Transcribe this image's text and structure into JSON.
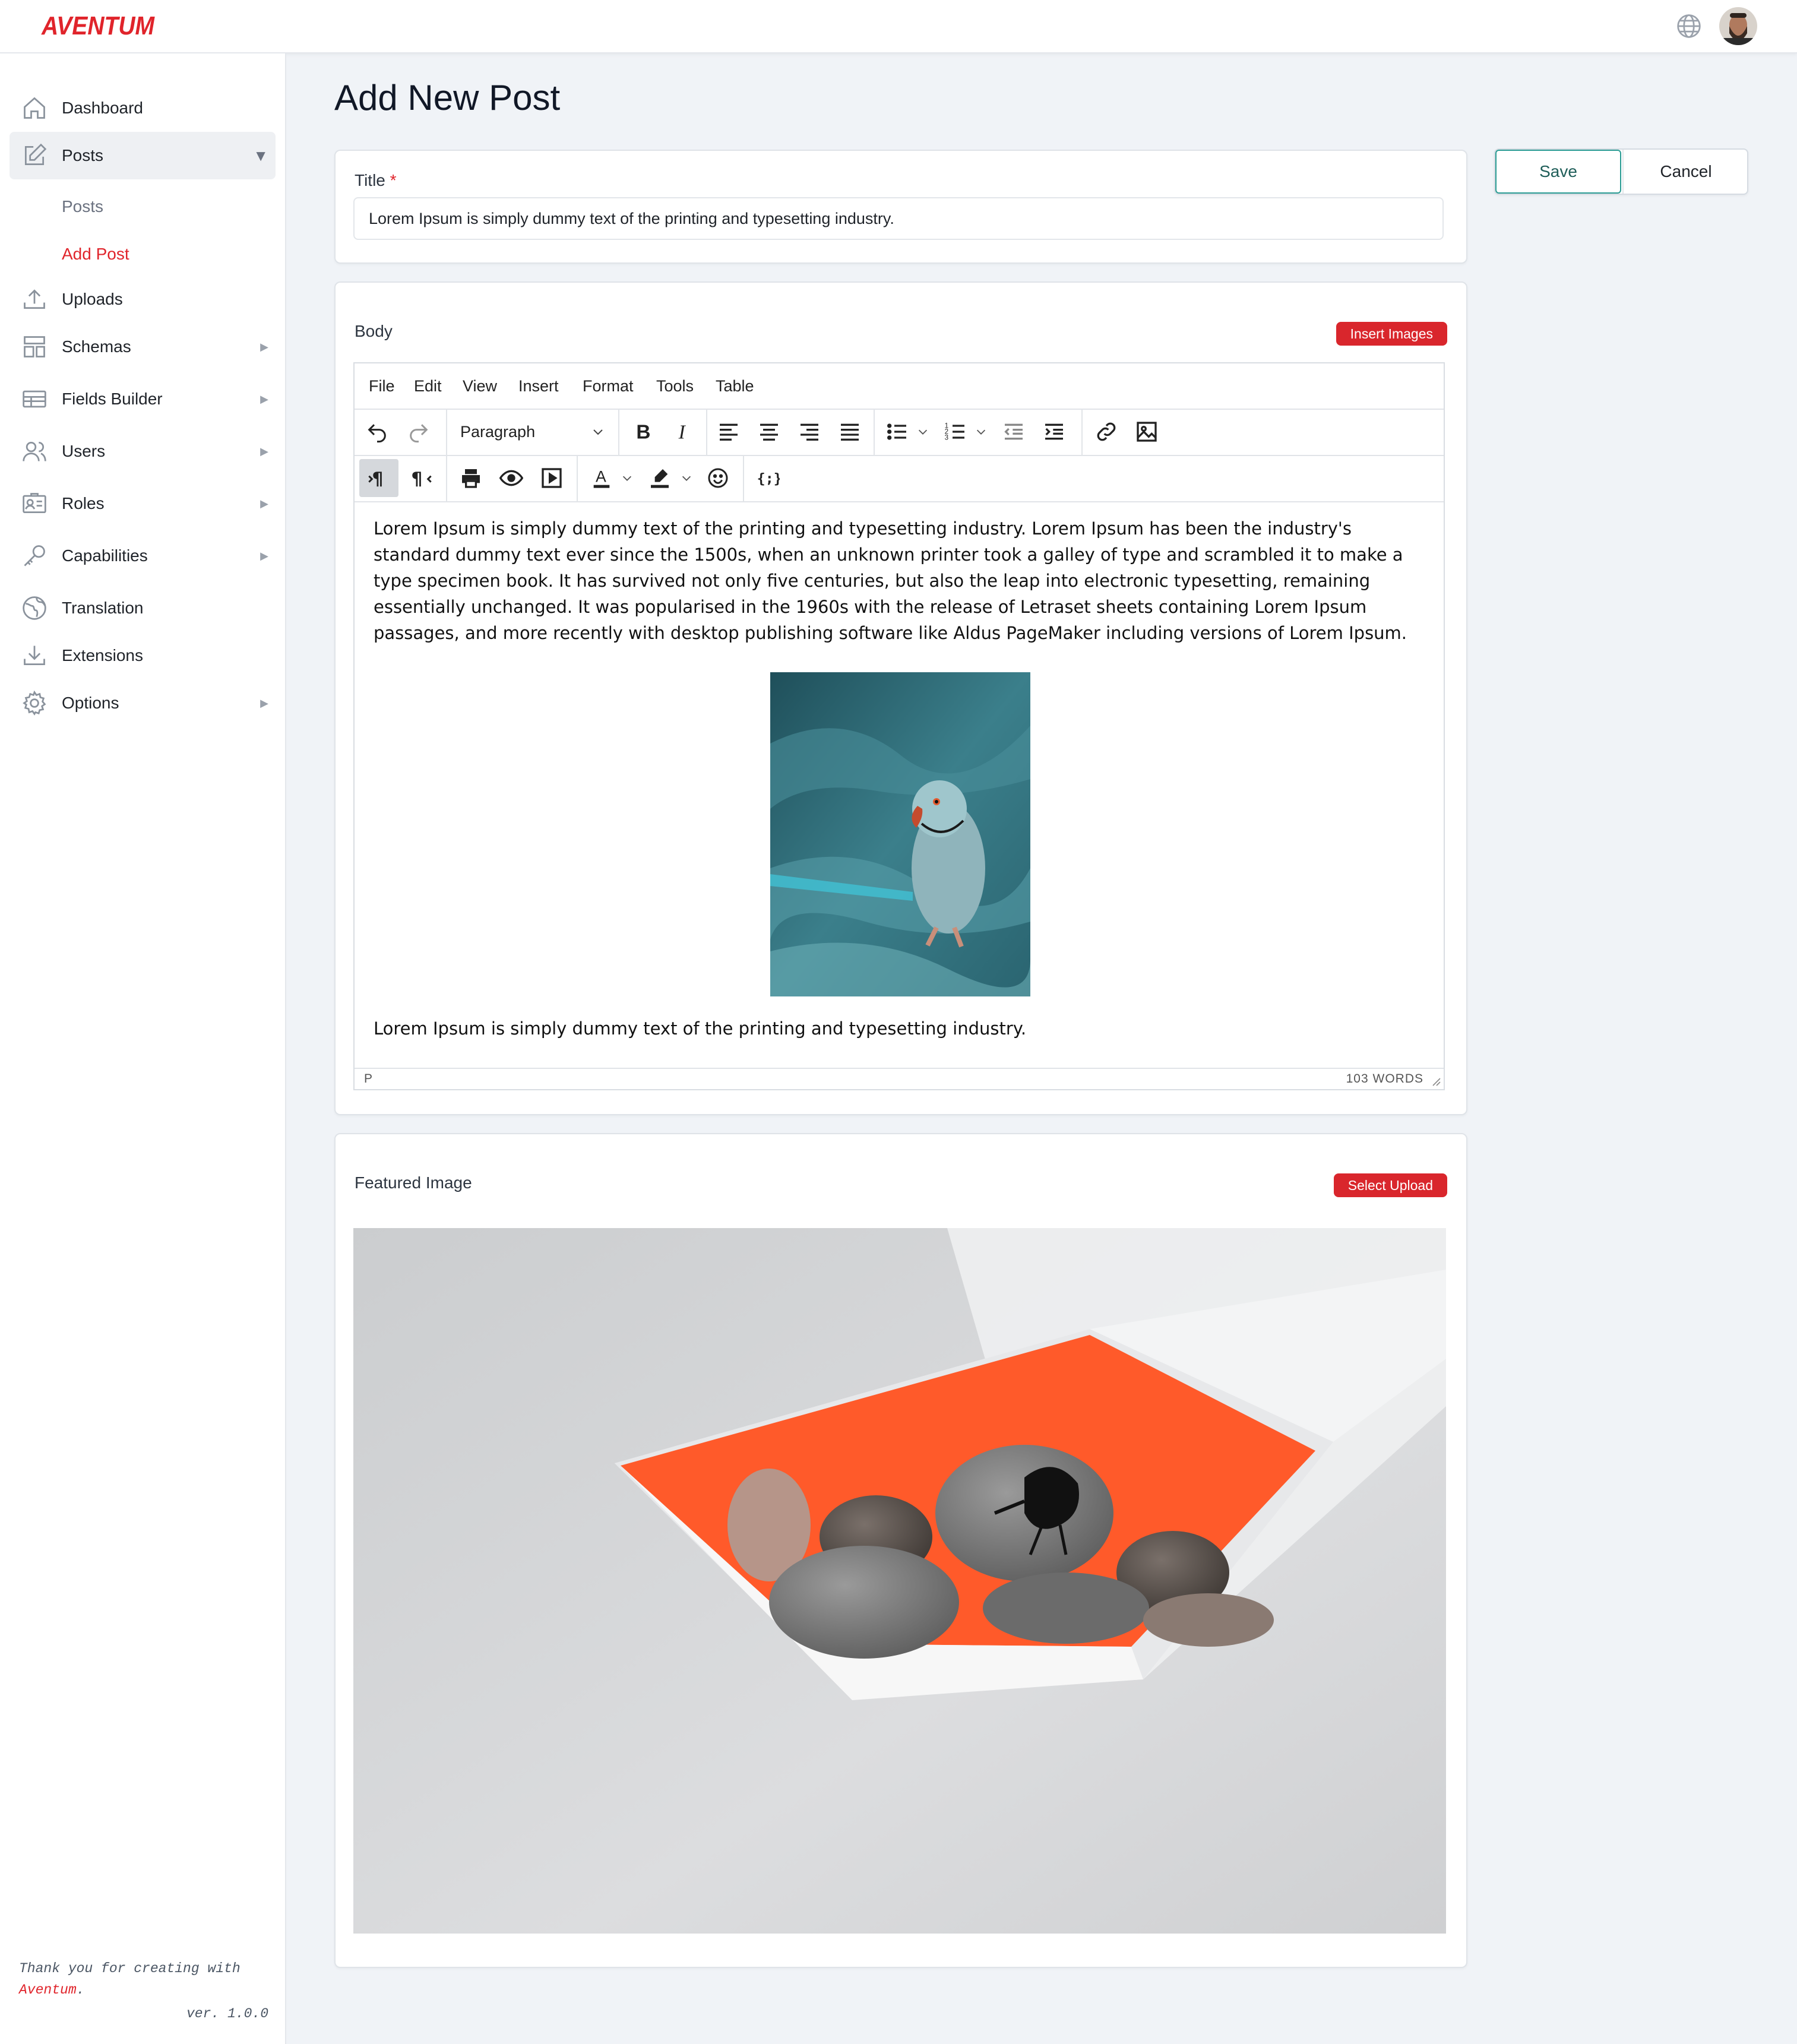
{
  "brand": {
    "logo_text": "AVENTUM"
  },
  "colors": {
    "accent": "#e0242b",
    "save_border": "#2b9c94",
    "page_bg": "#f0f3f7"
  },
  "header": {
    "language_icon": "globe-icon",
    "user_avatar": "avatar"
  },
  "sidebar": {
    "items": [
      {
        "label": "Dashboard",
        "icon": "home-icon"
      },
      {
        "label": "Posts",
        "icon": "edit-icon",
        "expanded": true
      },
      {
        "label": "Uploads",
        "icon": "upload-icon"
      },
      {
        "label": "Schemas",
        "icon": "layout-icon"
      },
      {
        "label": "Fields Builder",
        "icon": "table-icon"
      },
      {
        "label": "Users",
        "icon": "users-icon"
      },
      {
        "label": "Roles",
        "icon": "id-card-icon"
      },
      {
        "label": "Capabilities",
        "icon": "key-icon"
      },
      {
        "label": "Translation",
        "icon": "globe-icon"
      },
      {
        "label": "Extensions",
        "icon": "download-icon"
      },
      {
        "label": "Options",
        "icon": "gear-icon"
      }
    ],
    "posts_sub": [
      {
        "label": "Posts"
      },
      {
        "label": "Add Post",
        "current": true
      }
    ],
    "footer": {
      "line1": "Thank you for creating with",
      "brand": "Aventum",
      "period": ".",
      "version": "ver. 1.0.0"
    }
  },
  "page": {
    "title": "Add New Post"
  },
  "actions": {
    "save": "Save",
    "cancel": "Cancel"
  },
  "title_field": {
    "label": "Title",
    "required_mark": "*",
    "value": "Lorem Ipsum is simply dummy text of the printing and typesetting industry."
  },
  "body_field": {
    "label": "Body",
    "insert_images": "Insert Images",
    "menu": [
      "File",
      "Edit",
      "View",
      "Insert",
      "Format",
      "Tools",
      "Table"
    ],
    "block_format": "Paragraph",
    "paragraph1": "Lorem Ipsum is simply dummy text of the printing and typesetting industry. Lorem Ipsum has been the industry's standard dummy text ever since the 1500s, when an unknown printer took a galley of type and scrambled it to make a type specimen book. It has survived not only five centuries, but also the leap into electronic typesetting, remaining essentially unchanged. It was popularised in the 1960s with the release of Letraset sheets containing Lorem Ipsum passages, and more recently with desktop publishing software like Aldus PageMaker including versions of Lorem Ipsum.",
    "paragraph2": "Lorem Ipsum is simply dummy text of the printing and typesetting industry.",
    "status_path": "P",
    "word_count": "103 WORDS"
  },
  "featured": {
    "label": "Featured Image",
    "select_upload": "Select Upload"
  }
}
